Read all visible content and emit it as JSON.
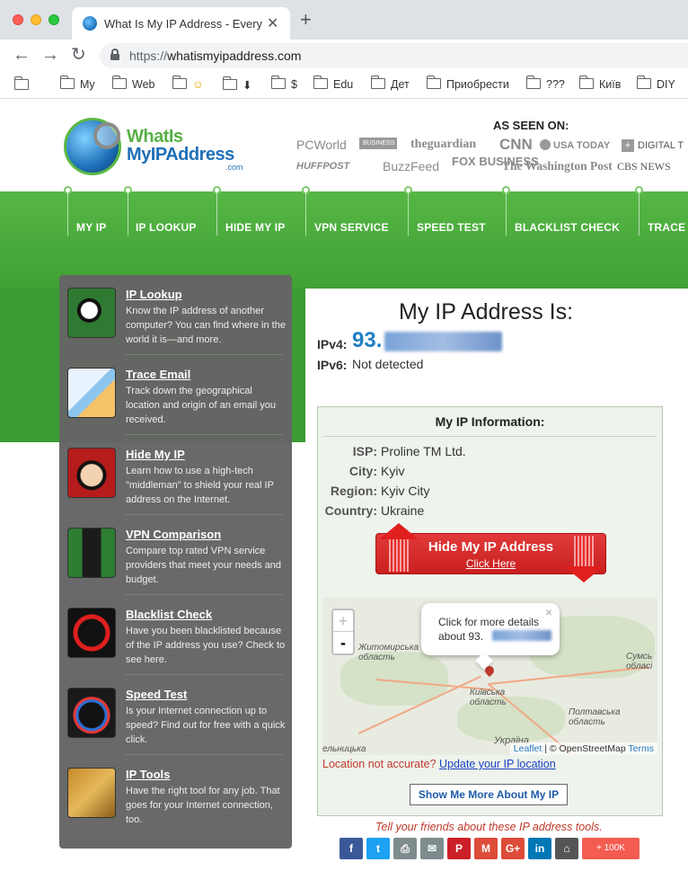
{
  "browser": {
    "tab_title": "What Is My IP Address - Everyt",
    "tab_close": "✕",
    "new_tab": "+",
    "url_prefix": "https://",
    "url_host": "whatismyipaddress.com",
    "nav": {
      "back": "←",
      "forward": "→",
      "reload": "↻"
    },
    "bookmarks": [
      {
        "label": ""
      },
      {
        "label": "My"
      },
      {
        "label": "Web"
      },
      {
        "label": "☺"
      },
      {
        "label": "⬇"
      },
      {
        "label": "$"
      },
      {
        "label": "Edu"
      },
      {
        "label": "Дет"
      },
      {
        "label": "Приобрести"
      },
      {
        "label": "???"
      },
      {
        "label": "Київ"
      },
      {
        "label": "DIY"
      }
    ]
  },
  "logo": {
    "line1": "WhatIs",
    "line2": "MyIPAddress",
    "com": ".com"
  },
  "as_seen_on": {
    "title": "AS SEEN ON:",
    "outlets": [
      "PCWorld",
      "BUSINESS INSIDER",
      "theguardian",
      "CNN",
      "USA TODAY",
      "DIGITAL T",
      "HUFFPOST",
      "BuzzFeed",
      "FOX BUSINESS",
      "The Washington Post",
      "CBS NEWS"
    ]
  },
  "nav": [
    "MY IP",
    "IP LOOKUP",
    "HIDE MY IP",
    "VPN SERVICE",
    "SPEED TEST",
    "BLACKLIST CHECK",
    "TRACE"
  ],
  "sidebar": [
    {
      "title": "IP Lookup",
      "desc": "Know the IP address of another computer? You can find where in the world it is—and more.",
      "icon": "ip-lookup-icon"
    },
    {
      "title": "Trace Email",
      "desc": "Track down the geographical location and origin of an email you received.",
      "icon": "trace-email-icon"
    },
    {
      "title": "Hide My IP",
      "desc": "Learn how to use a high-tech \"middleman\" to shield your real IP address on the Internet.",
      "icon": "hide-ip-icon"
    },
    {
      "title": "VPN Comparison",
      "desc": "Compare top rated VPN service providers that meet your needs and budget.",
      "icon": "vpn-icon"
    },
    {
      "title": "Blacklist Check",
      "desc": "Have you been blacklisted because of the IP address you use? Check to see here.",
      "icon": "blacklist-icon"
    },
    {
      "title": "Speed Test",
      "desc": "Is your Internet connection up to speed? Find out for free with a quick click.",
      "icon": "speed-test-icon"
    },
    {
      "title": "IP Tools",
      "desc": "Have the right tool for any job. That goes for your Internet connection, too.",
      "icon": "ip-tools-icon"
    }
  ],
  "main": {
    "title": "My IP Address Is:",
    "ipv4_label": "IPv4:",
    "ipv4_visible": "93.",
    "ipv6_label": "IPv6:",
    "ipv6_value": "Not detected"
  },
  "info": {
    "title": "My IP Information:",
    "rows": [
      {
        "label": "ISP:",
        "value": "Proline TM Ltd."
      },
      {
        "label": "City:",
        "value": "Kyiv"
      },
      {
        "label": "Region:",
        "value": "Kyiv City"
      },
      {
        "label": "Country:",
        "value": "Ukraine"
      }
    ],
    "hide_button": "Hide My IP Address",
    "hide_button_sub": "Click Here",
    "map": {
      "zoom_in": "+",
      "zoom_out": "-",
      "popup_line1": "Click for more details",
      "popup_line2": "about 93.",
      "popup_close": "×",
      "labels": [
        "Житомирська область",
        "Київська область",
        "Сумсь обласі",
        "Полтавська область",
        "Україна",
        "ельницька"
      ],
      "attribution_leaflet": "Leaflet",
      "attribution_sep": " | © ",
      "attribution_osm": "OpenStreetMap",
      "attribution_terms": "Terms"
    },
    "location_question": "Location not accurate?",
    "location_link": "Update your IP location",
    "more_button": "Show Me More About My IP"
  },
  "share": {
    "tagline": "Tell your friends about these IP address tools.",
    "buttons": [
      {
        "icon": "facebook-icon",
        "glyph": "f",
        "color": "#3b5998"
      },
      {
        "icon": "twitter-icon",
        "glyph": "t",
        "color": "#1da1f2"
      },
      {
        "icon": "print-icon",
        "glyph": "⎙",
        "color": "#7f8c8d"
      },
      {
        "icon": "email-icon",
        "glyph": "✉",
        "color": "#7f8c8d"
      },
      {
        "icon": "pinterest-icon",
        "glyph": "P",
        "color": "#cb2027"
      },
      {
        "icon": "gmail-icon",
        "glyph": "M",
        "color": "#dd4b39"
      },
      {
        "icon": "google-plus-icon",
        "glyph": "G+",
        "color": "#dd4b39"
      },
      {
        "icon": "linkedin-icon",
        "glyph": "in",
        "color": "#0077b5"
      },
      {
        "icon": "inbox-icon",
        "glyph": "⌂",
        "color": "#555555"
      }
    ],
    "count": "+ 100K"
  }
}
